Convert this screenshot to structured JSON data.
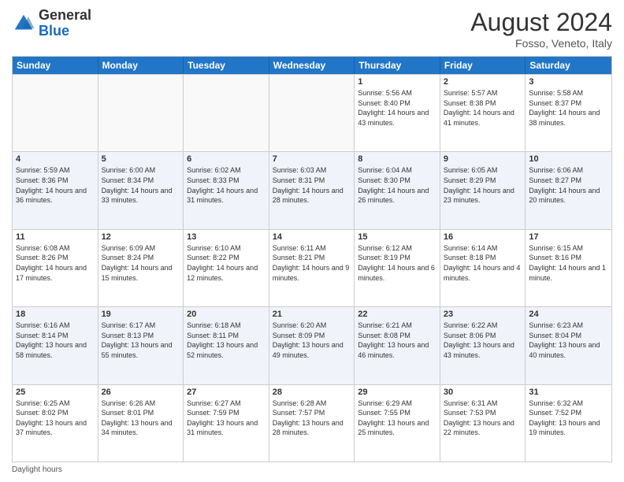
{
  "logo": {
    "general": "General",
    "blue": "Blue"
  },
  "header": {
    "month_year": "August 2024",
    "location": "Fosso, Veneto, Italy"
  },
  "days_of_week": [
    "Sunday",
    "Monday",
    "Tuesday",
    "Wednesday",
    "Thursday",
    "Friday",
    "Saturday"
  ],
  "footer": {
    "daylight_label": "Daylight hours"
  },
  "weeks": [
    {
      "cells": [
        {
          "day": "",
          "empty": true
        },
        {
          "day": "",
          "empty": true
        },
        {
          "day": "",
          "empty": true
        },
        {
          "day": "",
          "empty": true
        },
        {
          "day": "1",
          "sunrise": "Sunrise: 5:56 AM",
          "sunset": "Sunset: 8:40 PM",
          "daylight": "Daylight: 14 hours and 43 minutes."
        },
        {
          "day": "2",
          "sunrise": "Sunrise: 5:57 AM",
          "sunset": "Sunset: 8:38 PM",
          "daylight": "Daylight: 14 hours and 41 minutes."
        },
        {
          "day": "3",
          "sunrise": "Sunrise: 5:58 AM",
          "sunset": "Sunset: 8:37 PM",
          "daylight": "Daylight: 14 hours and 38 minutes."
        }
      ]
    },
    {
      "cells": [
        {
          "day": "4",
          "sunrise": "Sunrise: 5:59 AM",
          "sunset": "Sunset: 8:36 PM",
          "daylight": "Daylight: 14 hours and 36 minutes."
        },
        {
          "day": "5",
          "sunrise": "Sunrise: 6:00 AM",
          "sunset": "Sunset: 8:34 PM",
          "daylight": "Daylight: 14 hours and 33 minutes."
        },
        {
          "day": "6",
          "sunrise": "Sunrise: 6:02 AM",
          "sunset": "Sunset: 8:33 PM",
          "daylight": "Daylight: 14 hours and 31 minutes."
        },
        {
          "day": "7",
          "sunrise": "Sunrise: 6:03 AM",
          "sunset": "Sunset: 8:31 PM",
          "daylight": "Daylight: 14 hours and 28 minutes."
        },
        {
          "day": "8",
          "sunrise": "Sunrise: 6:04 AM",
          "sunset": "Sunset: 8:30 PM",
          "daylight": "Daylight: 14 hours and 26 minutes."
        },
        {
          "day": "9",
          "sunrise": "Sunrise: 6:05 AM",
          "sunset": "Sunset: 8:29 PM",
          "daylight": "Daylight: 14 hours and 23 minutes."
        },
        {
          "day": "10",
          "sunrise": "Sunrise: 6:06 AM",
          "sunset": "Sunset: 8:27 PM",
          "daylight": "Daylight: 14 hours and 20 minutes."
        }
      ]
    },
    {
      "cells": [
        {
          "day": "11",
          "sunrise": "Sunrise: 6:08 AM",
          "sunset": "Sunset: 8:26 PM",
          "daylight": "Daylight: 14 hours and 17 minutes."
        },
        {
          "day": "12",
          "sunrise": "Sunrise: 6:09 AM",
          "sunset": "Sunset: 8:24 PM",
          "daylight": "Daylight: 14 hours and 15 minutes."
        },
        {
          "day": "13",
          "sunrise": "Sunrise: 6:10 AM",
          "sunset": "Sunset: 8:22 PM",
          "daylight": "Daylight: 14 hours and 12 minutes."
        },
        {
          "day": "14",
          "sunrise": "Sunrise: 6:11 AM",
          "sunset": "Sunset: 8:21 PM",
          "daylight": "Daylight: 14 hours and 9 minutes."
        },
        {
          "day": "15",
          "sunrise": "Sunrise: 6:12 AM",
          "sunset": "Sunset: 8:19 PM",
          "daylight": "Daylight: 14 hours and 6 minutes."
        },
        {
          "day": "16",
          "sunrise": "Sunrise: 6:14 AM",
          "sunset": "Sunset: 8:18 PM",
          "daylight": "Daylight: 14 hours and 4 minutes."
        },
        {
          "day": "17",
          "sunrise": "Sunrise: 6:15 AM",
          "sunset": "Sunset: 8:16 PM",
          "daylight": "Daylight: 14 hours and 1 minute."
        }
      ]
    },
    {
      "cells": [
        {
          "day": "18",
          "sunrise": "Sunrise: 6:16 AM",
          "sunset": "Sunset: 8:14 PM",
          "daylight": "Daylight: 13 hours and 58 minutes."
        },
        {
          "day": "19",
          "sunrise": "Sunrise: 6:17 AM",
          "sunset": "Sunset: 8:13 PM",
          "daylight": "Daylight: 13 hours and 55 minutes."
        },
        {
          "day": "20",
          "sunrise": "Sunrise: 6:18 AM",
          "sunset": "Sunset: 8:11 PM",
          "daylight": "Daylight: 13 hours and 52 minutes."
        },
        {
          "day": "21",
          "sunrise": "Sunrise: 6:20 AM",
          "sunset": "Sunset: 8:09 PM",
          "daylight": "Daylight: 13 hours and 49 minutes."
        },
        {
          "day": "22",
          "sunrise": "Sunrise: 6:21 AM",
          "sunset": "Sunset: 8:08 PM",
          "daylight": "Daylight: 13 hours and 46 minutes."
        },
        {
          "day": "23",
          "sunrise": "Sunrise: 6:22 AM",
          "sunset": "Sunset: 8:06 PM",
          "daylight": "Daylight: 13 hours and 43 minutes."
        },
        {
          "day": "24",
          "sunrise": "Sunrise: 6:23 AM",
          "sunset": "Sunset: 8:04 PM",
          "daylight": "Daylight: 13 hours and 40 minutes."
        }
      ]
    },
    {
      "cells": [
        {
          "day": "25",
          "sunrise": "Sunrise: 6:25 AM",
          "sunset": "Sunset: 8:02 PM",
          "daylight": "Daylight: 13 hours and 37 minutes."
        },
        {
          "day": "26",
          "sunrise": "Sunrise: 6:26 AM",
          "sunset": "Sunset: 8:01 PM",
          "daylight": "Daylight: 13 hours and 34 minutes."
        },
        {
          "day": "27",
          "sunrise": "Sunrise: 6:27 AM",
          "sunset": "Sunset: 7:59 PM",
          "daylight": "Daylight: 13 hours and 31 minutes."
        },
        {
          "day": "28",
          "sunrise": "Sunrise: 6:28 AM",
          "sunset": "Sunset: 7:57 PM",
          "daylight": "Daylight: 13 hours and 28 minutes."
        },
        {
          "day": "29",
          "sunrise": "Sunrise: 6:29 AM",
          "sunset": "Sunset: 7:55 PM",
          "daylight": "Daylight: 13 hours and 25 minutes."
        },
        {
          "day": "30",
          "sunrise": "Sunrise: 6:31 AM",
          "sunset": "Sunset: 7:53 PM",
          "daylight": "Daylight: 13 hours and 22 minutes."
        },
        {
          "day": "31",
          "sunrise": "Sunrise: 6:32 AM",
          "sunset": "Sunset: 7:52 PM",
          "daylight": "Daylight: 13 hours and 19 minutes."
        }
      ]
    }
  ]
}
